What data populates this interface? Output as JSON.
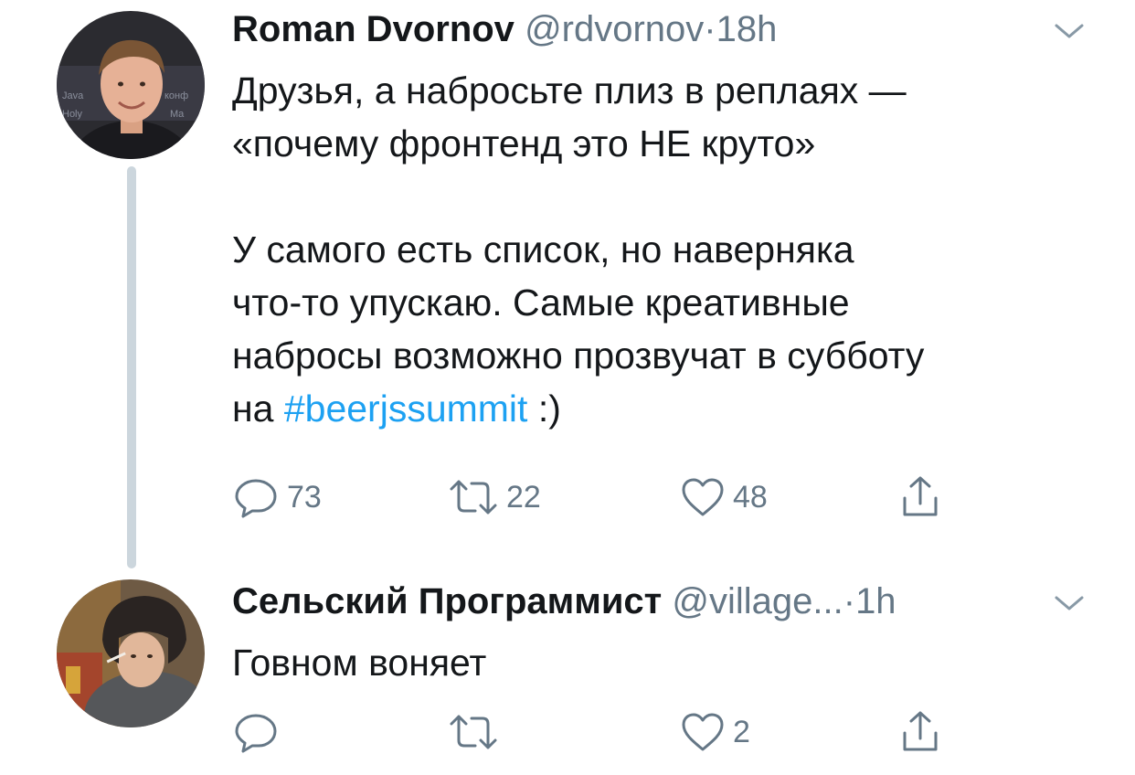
{
  "tweets": [
    {
      "author_name": "Roman Dvornov",
      "handle": "@rdvornov",
      "separator": "·",
      "time": "18h",
      "text_lines": [
        "Друзья, а набросьте плиз в реплаях —",
        "«почему фронтенд это НЕ круто»"
      ],
      "text_lines_2": [
        "У самого есть список, но наверняка",
        "что-то упускаю. Самые креативные",
        "набросы возможно прозвучат в субботу"
      ],
      "last_line_prefix": "на ",
      "hashtag": "#beerjssummit",
      "last_line_suffix": " :)",
      "avatar_badges": [
        "Java",
        "конф",
        "Holy",
        "Ma"
      ],
      "counts": {
        "replies": "73",
        "retweets": "22",
        "likes": "48"
      },
      "icons": [
        "reply-icon",
        "retweet-icon",
        "like-icon",
        "share-icon",
        "chevron-down-icon"
      ]
    },
    {
      "author_name": "Сельский Программист",
      "handle": "@village...",
      "separator": "·",
      "time": "1h",
      "text": "Говном воняет",
      "counts": {
        "replies": "",
        "retweets": "",
        "likes": "2"
      },
      "icons": [
        "reply-icon",
        "retweet-icon",
        "like-icon",
        "share-icon",
        "chevron-down-icon"
      ]
    }
  ],
  "colors": {
    "text": "#14171a",
    "secondary": "#657786",
    "hashtag": "#1da1f2",
    "thread_line": "#ccd6dd"
  }
}
